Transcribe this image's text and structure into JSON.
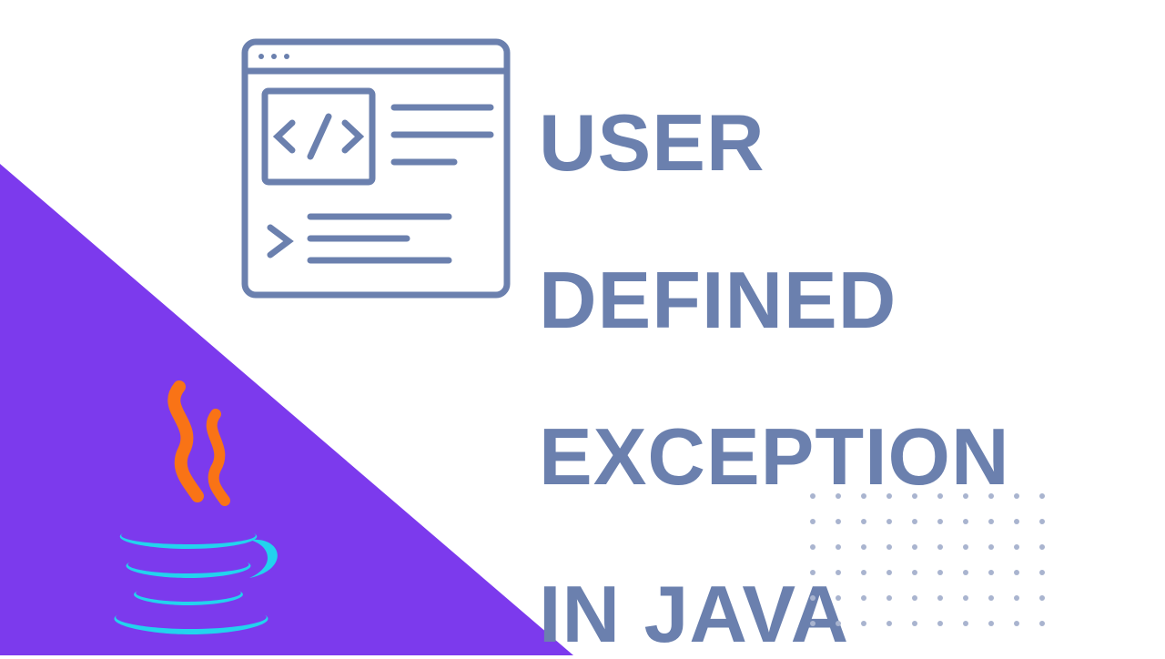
{
  "colors": {
    "triangle": "#7c3aed",
    "heading": "#6b80ae",
    "icon_stroke": "#6b80ae",
    "dots": "#a9b4cf",
    "java_cup": "#22d3ee",
    "java_steam": "#f97316"
  },
  "heading": {
    "line1": "USER",
    "line2": "DEFINED",
    "line3": "EXCEPTION",
    "line4": "IN JAVA"
  },
  "code_icon": {
    "symbol": "</>"
  },
  "dot_grid": {
    "rows": 6,
    "cols": 10
  }
}
